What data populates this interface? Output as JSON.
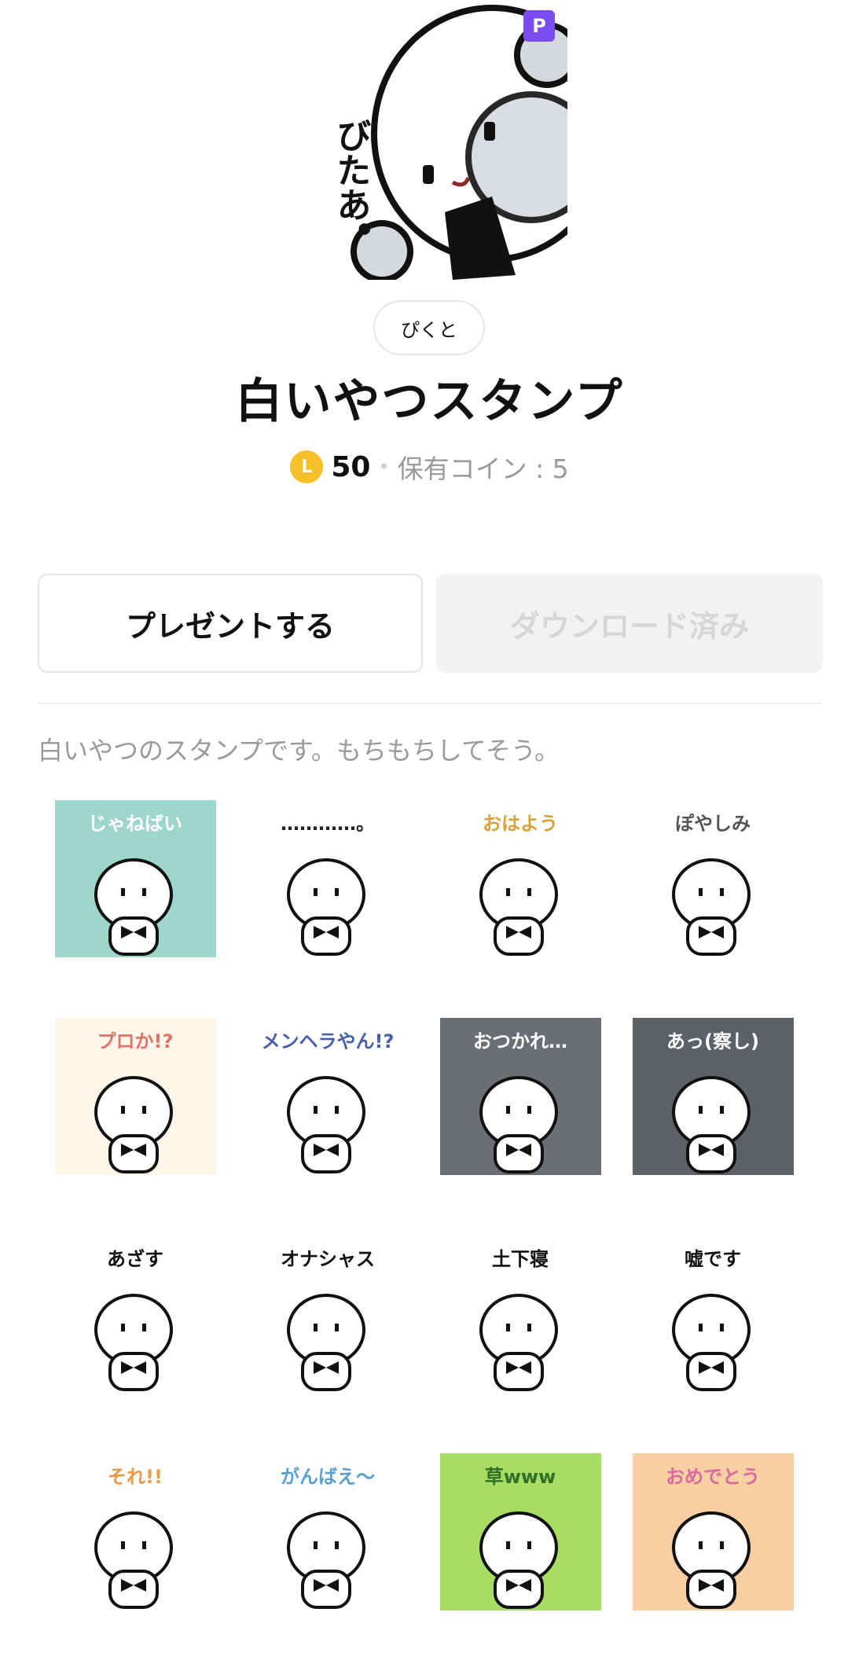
{
  "header": {
    "premium_badge": "P",
    "hero_text": "びたあ。"
  },
  "author": "ぴくと",
  "title": "白いやつスタンプ",
  "price": {
    "coin_letter": "L",
    "amount": "50",
    "separator": "•",
    "owned_label": "保有コイン : 5"
  },
  "buttons": {
    "gift": "プレゼントする",
    "download": "ダウンロード済み"
  },
  "description": "白いやつのスタンプです。もちもちしてそう。",
  "stickers": [
    {
      "caption": "じゃねばい",
      "bg": "#9fd6cc",
      "caption_color": "#ffffff"
    },
    {
      "caption": "…………。",
      "bg": "#ffffff",
      "caption_color": "#222222"
    },
    {
      "caption": "おはよう",
      "bg": "#ffffff",
      "caption_color": "#d9a23b"
    },
    {
      "caption": "ぽやしみ",
      "bg": "#ffffff",
      "caption_color": "#555555"
    },
    {
      "caption": "プロか!?",
      "bg": "#fff6ea",
      "caption_color": "#e0736a"
    },
    {
      "caption": "メンヘラやん!?",
      "bg": "#ffffff",
      "caption_color": "#4b5fa8"
    },
    {
      "caption": "おつかれ…",
      "bg": "#6b6f73",
      "caption_color": "#ffffff"
    },
    {
      "caption": "あっ(察し)",
      "bg": "#5d6166",
      "caption_color": "#ffffff"
    },
    {
      "caption": "あざす",
      "bg": "#ffffff",
      "caption_color": "#111111"
    },
    {
      "caption": "オナシャス",
      "bg": "#ffffff",
      "caption_color": "#111111"
    },
    {
      "caption": "土下寝",
      "bg": "#ffffff",
      "caption_color": "#111111"
    },
    {
      "caption": "嘘です",
      "bg": "#ffffff",
      "caption_color": "#111111"
    },
    {
      "caption": "それ!!",
      "bg": "#ffffff",
      "caption_color": "#e79a4a"
    },
    {
      "caption": "がんばえ〜",
      "bg": "#ffffff",
      "caption_color": "#5aa0d6"
    },
    {
      "caption": "草www",
      "bg": "#a8dd63",
      "caption_color": "#2f6f2a"
    },
    {
      "caption": "おめでとう",
      "bg": "#f6cfa3",
      "caption_color": "#d86aa0"
    }
  ]
}
